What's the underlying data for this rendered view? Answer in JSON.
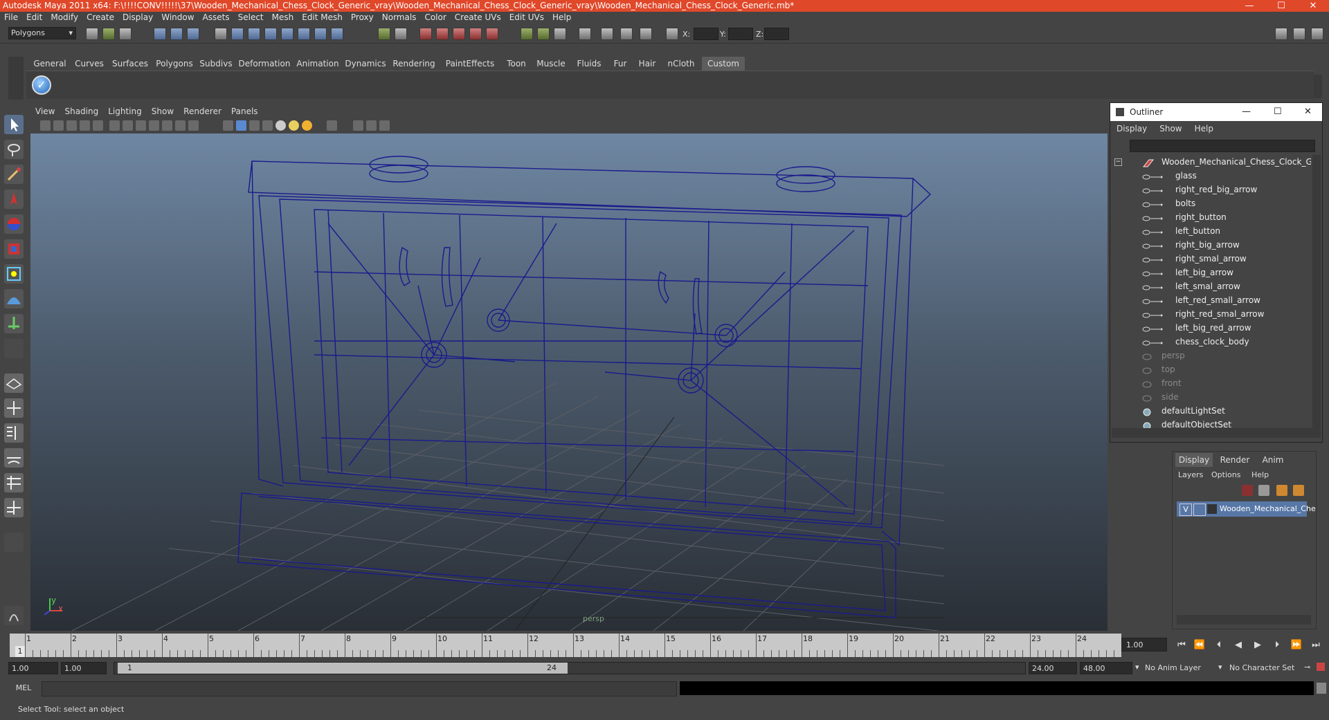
{
  "window": {
    "title": "Autodesk Maya 2011 x64: F:\\!!!!CONV!!!!!\\37\\Wooden_Mechanical_Chess_Clock_Generic_vray\\Wooden_Mechanical_Chess_Clock_Generic_vray\\Wooden_Mechanical_Chess_Clock_Generic.mb*",
    "minimize": "—",
    "maximize": "☐",
    "close": "✕"
  },
  "menubar": [
    "File",
    "Edit",
    "Modify",
    "Create",
    "Display",
    "Window",
    "Assets",
    "Select",
    "Mesh",
    "Edit Mesh",
    "Proxy",
    "Normals",
    "Color",
    "Create UVs",
    "Edit UVs",
    "Help"
  ],
  "statusline": {
    "mode": "Polygons",
    "x_label": "X:",
    "y_label": "Y:",
    "z_label": "Z:"
  },
  "shelf": {
    "tabs": [
      "General",
      "Curves",
      "Surfaces",
      "Polygons",
      "Subdivs",
      "Deformation",
      "Animation",
      "Dynamics",
      "Rendering",
      "PaintEffects",
      "Toon",
      "Muscle",
      "Fluids",
      "Fur",
      "Hair",
      "nCloth",
      "Custom"
    ],
    "active_tab": "Custom"
  },
  "viewport": {
    "menu": [
      "View",
      "Shading",
      "Lighting",
      "Show",
      "Renderer",
      "Panels"
    ],
    "camera_label": "persp",
    "axis_x": "x",
    "axis_y": "y"
  },
  "outliner": {
    "title": "Outliner",
    "menu": [
      "Display",
      "Show",
      "Help"
    ],
    "items": [
      {
        "label": "Wooden_Mechanical_Chess_Clock_Generic",
        "level": 0,
        "dim": false
      },
      {
        "label": "glass",
        "level": 1,
        "dim": false
      },
      {
        "label": "right_red_big_arrow",
        "level": 1,
        "dim": false
      },
      {
        "label": "bolts",
        "level": 1,
        "dim": false
      },
      {
        "label": "right_button",
        "level": 1,
        "dim": false
      },
      {
        "label": "left_button",
        "level": 1,
        "dim": false
      },
      {
        "label": "right_big_arrow",
        "level": 1,
        "dim": false
      },
      {
        "label": "right_smal_arrow",
        "level": 1,
        "dim": false
      },
      {
        "label": "left_big_arrow",
        "level": 1,
        "dim": false
      },
      {
        "label": "left_smal_arrow",
        "level": 1,
        "dim": false
      },
      {
        "label": "left_red_small_arrow",
        "level": 1,
        "dim": false
      },
      {
        "label": "right_red_smal_arrow",
        "level": 1,
        "dim": false
      },
      {
        "label": "left_big_red_arrow",
        "level": 1,
        "dim": false
      },
      {
        "label": "chess_clock_body",
        "level": 1,
        "dim": false
      },
      {
        "label": "persp",
        "level": 0,
        "dim": true
      },
      {
        "label": "top",
        "level": 0,
        "dim": true
      },
      {
        "label": "front",
        "level": 0,
        "dim": true
      },
      {
        "label": "side",
        "level": 0,
        "dim": true
      },
      {
        "label": "defaultLightSet",
        "level": 0,
        "dim": false
      },
      {
        "label": "defaultObjectSet",
        "level": 0,
        "dim": false
      }
    ]
  },
  "layer_editor": {
    "tabs": [
      "Display",
      "Render",
      "Anim"
    ],
    "active_tab": "Display",
    "menu": [
      "Layers",
      "Options",
      "Help"
    ],
    "layer_visible": "V",
    "layer_name": "Wooden_Mechanical_Che"
  },
  "timeline": {
    "frames": [
      "1",
      "2",
      "3",
      "4",
      "5",
      "6",
      "7",
      "8",
      "9",
      "10",
      "11",
      "12",
      "13",
      "14",
      "15",
      "16",
      "17",
      "18",
      "19",
      "20",
      "21",
      "22",
      "23",
      "24"
    ],
    "current_frame_marker": "1",
    "current_time": "1.00"
  },
  "range": {
    "start": "1.00",
    "playback_start": "1.00",
    "thumb_start": "1",
    "thumb_end": "24",
    "playback_end": "24.00",
    "end": "48.00",
    "anim_layer": "No Anim Layer",
    "character_set": "No Character Set"
  },
  "command": {
    "label": "MEL"
  },
  "helpline": "Select Tool: select an object",
  "colors": {
    "title_bar": "#e0482a",
    "wireframe": "#1a1a8c",
    "viewport_top": "#6f87a3",
    "viewport_bottom": "#2a2f36",
    "layer_selected": "#5777a6"
  }
}
